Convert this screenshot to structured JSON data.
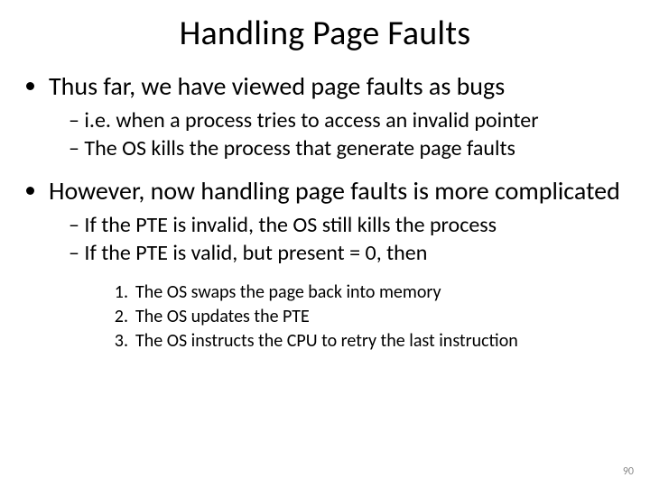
{
  "title": "Handling Page Faults",
  "bullets": [
    {
      "text": "Thus far, we have viewed page faults as bugs",
      "sub": [
        "i.e. when a process tries to access an invalid pointer",
        "The OS kills the process that generate page faults"
      ]
    },
    {
      "text": "However, now handling page faults is more complicated",
      "sub": [
        "If the PTE is invalid, the OS still kills the process",
        "If the PTE is valid, but present = 0, then"
      ],
      "numbered": [
        "The OS swaps the page back into memory",
        "The OS updates the PTE",
        "The OS instructs the CPU to retry the last instruction"
      ]
    }
  ],
  "page": "90"
}
